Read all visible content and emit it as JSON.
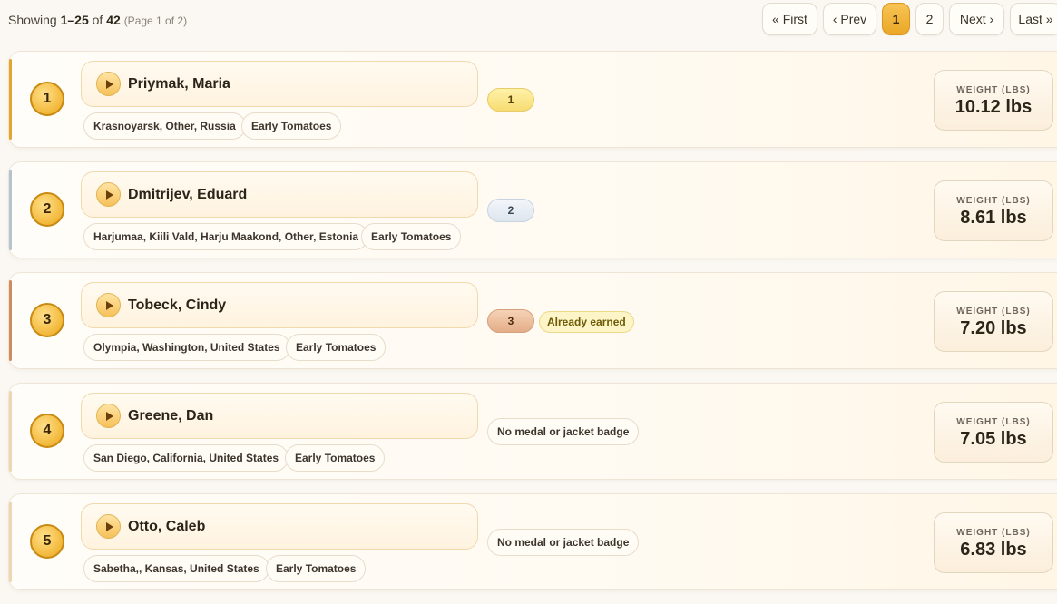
{
  "summary": {
    "prefix": "Showing ",
    "range": "1–25",
    "of": " of ",
    "total": "42",
    "page": "(Page 1 of 2)"
  },
  "pagination": {
    "first": "« First",
    "prev": "‹ Prev",
    "page1": "1",
    "page2": "2",
    "next": "Next ›",
    "last": "Last »"
  },
  "weight_label": "WEIGHT (LBS)",
  "colors": {
    "gold": "#f2b83a",
    "silver": "#e6edf5",
    "bronze": "#e9b894",
    "accent": "#eaa726"
  },
  "entries": [
    {
      "rank": "1",
      "name": "Priymak, Maria",
      "location": "Krasnoyarsk, Other, Russia",
      "category": "Early Tomatoes",
      "place": "1",
      "weight": "10.12 lbs"
    },
    {
      "rank": "2",
      "name": "Dmitrijev, Eduard",
      "location": "Harjumaa, Kiili Vald, Harju Maakond, Other, Estonia",
      "category": "Early Tomatoes",
      "place": "2",
      "weight": "8.61 lbs"
    },
    {
      "rank": "3",
      "name": "Tobeck, Cindy",
      "location": "Olympia, Washington, United States",
      "category": "Early Tomatoes",
      "place": "3",
      "earned": "Already earned",
      "weight": "7.20 lbs"
    },
    {
      "rank": "4",
      "name": "Greene, Dan",
      "location": "San Diego, California, United States",
      "category": "Early Tomatoes",
      "no_medal": "No medal or jacket badge",
      "weight": "7.05 lbs"
    },
    {
      "rank": "5",
      "name": "Otto, Caleb",
      "location": "Sabetha,, Kansas, United States",
      "category": "Early Tomatoes",
      "no_medal": "No medal or jacket badge",
      "weight": "6.83 lbs"
    }
  ]
}
